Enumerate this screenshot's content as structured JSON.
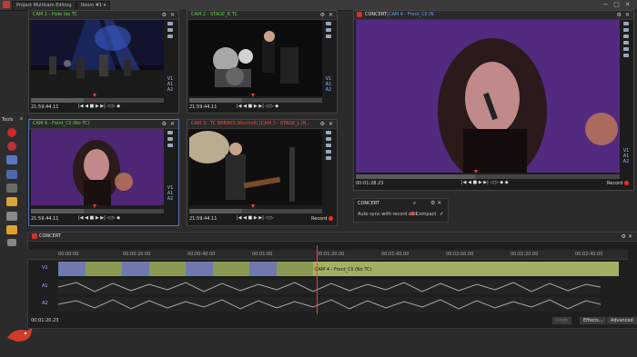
{
  "app": {
    "title": "Project Multicam Editing",
    "room": "Room #1",
    "window_controls": [
      "−",
      "□",
      "✕"
    ]
  },
  "tools": {
    "header": "Tools",
    "close": "x",
    "icons": [
      "record-icon",
      "record-icon",
      "storyboard-icon",
      "grid-icon",
      "list-icon",
      "folder-icon",
      "settings-icon",
      "export-icon",
      "users-icon"
    ]
  },
  "cams": [
    {
      "title": "CAM 1 - Hole Ids TC",
      "timecode": "21:59:44.11",
      "rec": ""
    },
    {
      "title": "CAM 2 - STAGE_R TC",
      "timecode": "21:59:44.11",
      "rec": ""
    },
    {
      "title": "CAM 4 - Front_Cll (No TC)",
      "timecode": "21:59:44.11",
      "rec": ""
    },
    {
      "title": "CAM 3 - TC BREAKS (Kontroll) [CAM 3 - STAGE_L (N...",
      "timecode": "21:59:44.11",
      "rec": "Record"
    }
  ],
  "main_viewer": {
    "label": "CONCERT",
    "title": "[CAM 4 - Front_Cll (N",
    "timecode": "00:01:28.23",
    "rec": "Record"
  },
  "side_tracks": [
    "V1",
    "A1",
    "A2"
  ],
  "concert_box": {
    "title": "CONCERT",
    "option": "Auto sync with record edit",
    "compact": "Compact"
  },
  "timeline": {
    "title": "CONCERT",
    "timecode": "00:01:20.23",
    "ruler": [
      "00:00:00",
      "00:00:20.00",
      "00:00:40.00",
      "00:01:00",
      "00:01:20.00",
      "00:01:40.00",
      "00:02:00.00",
      "00:02:20.00",
      "00:02:40.00"
    ],
    "tracks": [
      "V1",
      "A1",
      "A2"
    ],
    "clip_label": "CAM 4 - Front_Cll (No TC)",
    "audio_label": "...",
    "buttons": [
      "Undo",
      "Effects...",
      "Advanced"
    ]
  },
  "colors": {
    "accent_green": "#67d24d",
    "accent_red": "#ff3b3b",
    "v1_track": "#8a9a54"
  }
}
